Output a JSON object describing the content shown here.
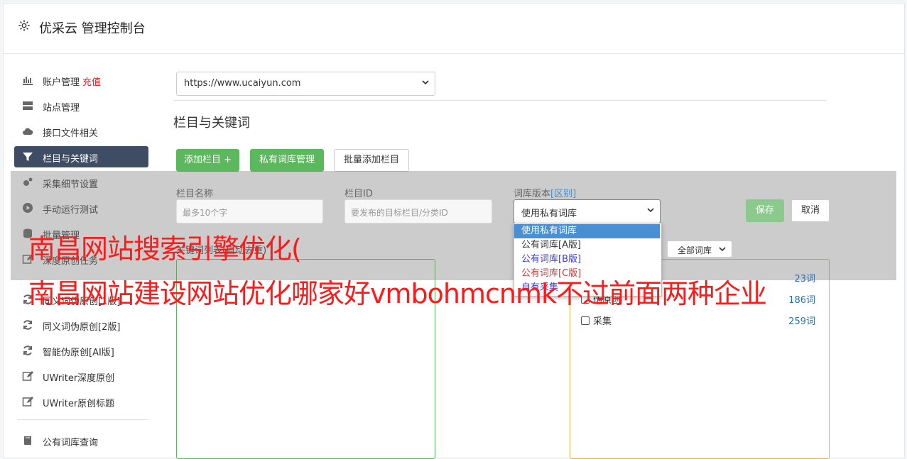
{
  "header": {
    "title": "优采云 管理控制台",
    "icon": "gear-icon"
  },
  "sidebar": {
    "items": [
      {
        "label": "账户管理",
        "badge": "充值",
        "icon": "bar-chart-icon"
      },
      {
        "label": "站点管理",
        "icon": "server-icon"
      },
      {
        "label": "接口文件相关",
        "icon": "cloud-upload-icon"
      },
      {
        "label": "栏目与关键词",
        "icon": "filter-icon",
        "active": true
      },
      {
        "label": "采集细节设置",
        "icon": "cogs-icon"
      },
      {
        "label": "手动运行测试",
        "icon": "play-circle-icon"
      },
      {
        "label": "批量管理",
        "icon": "database-icon"
      },
      {
        "label": "深度原创任务",
        "icon": "edit-icon"
      },
      {
        "label": "同义词伪原创[1版]",
        "icon": "refresh-icon"
      },
      {
        "label": "同义词伪原创[2版]",
        "icon": "refresh-icon"
      },
      {
        "label": "智能伪原创[AI版]",
        "icon": "refresh-icon"
      },
      {
        "label": "UWriter深度原创",
        "icon": "edit-icon"
      },
      {
        "label": "UWriter原创标题",
        "icon": "edit-icon"
      },
      {
        "label": "公有词库查询",
        "icon": "book-icon"
      }
    ]
  },
  "main": {
    "site_select": "https://www.ucaiyun.com",
    "section_title": "栏目与关键词",
    "buttons": {
      "add_column": "添加栏目 +",
      "private_lib": "私有词库管理",
      "batch_add": "批量添加栏目"
    },
    "form": {
      "name_label": "栏目名称",
      "name_placeholder": "最多10个字",
      "id_label": "栏目ID",
      "id_placeholder": "要发布的目标栏目/分类ID",
      "lib_label": "词库版本",
      "lib_label_link": "[区别]",
      "lib_value": "使用私有词库",
      "save": "保存",
      "cancel": "取消"
    },
    "dropdown_options": [
      "使用私有词库",
      "公有词库[A版]",
      "公有词库[B版]",
      "公有词库[C版]",
      "自有采集"
    ],
    "keyword_label": "关键词列表(自动去重)",
    "filter_select": "全部词库",
    "lib_stats": [
      {
        "label": "伪原创",
        "count": "186词"
      },
      {
        "label": "采集",
        "count": "259词"
      }
    ],
    "stats_first_count": "23词"
  },
  "watermark": {
    "line1": "南昌网站搜索引擎优化(",
    "line2": "南昌网站建设网站优化哪家好vmbohmcnmk不过前面两种企业"
  },
  "colors": {
    "accent": "#5cb85c",
    "sidebar_active": "#3e4c64",
    "link": "#3b8fd8",
    "badge": "#e02020",
    "watermark": "#ff1a1a"
  }
}
